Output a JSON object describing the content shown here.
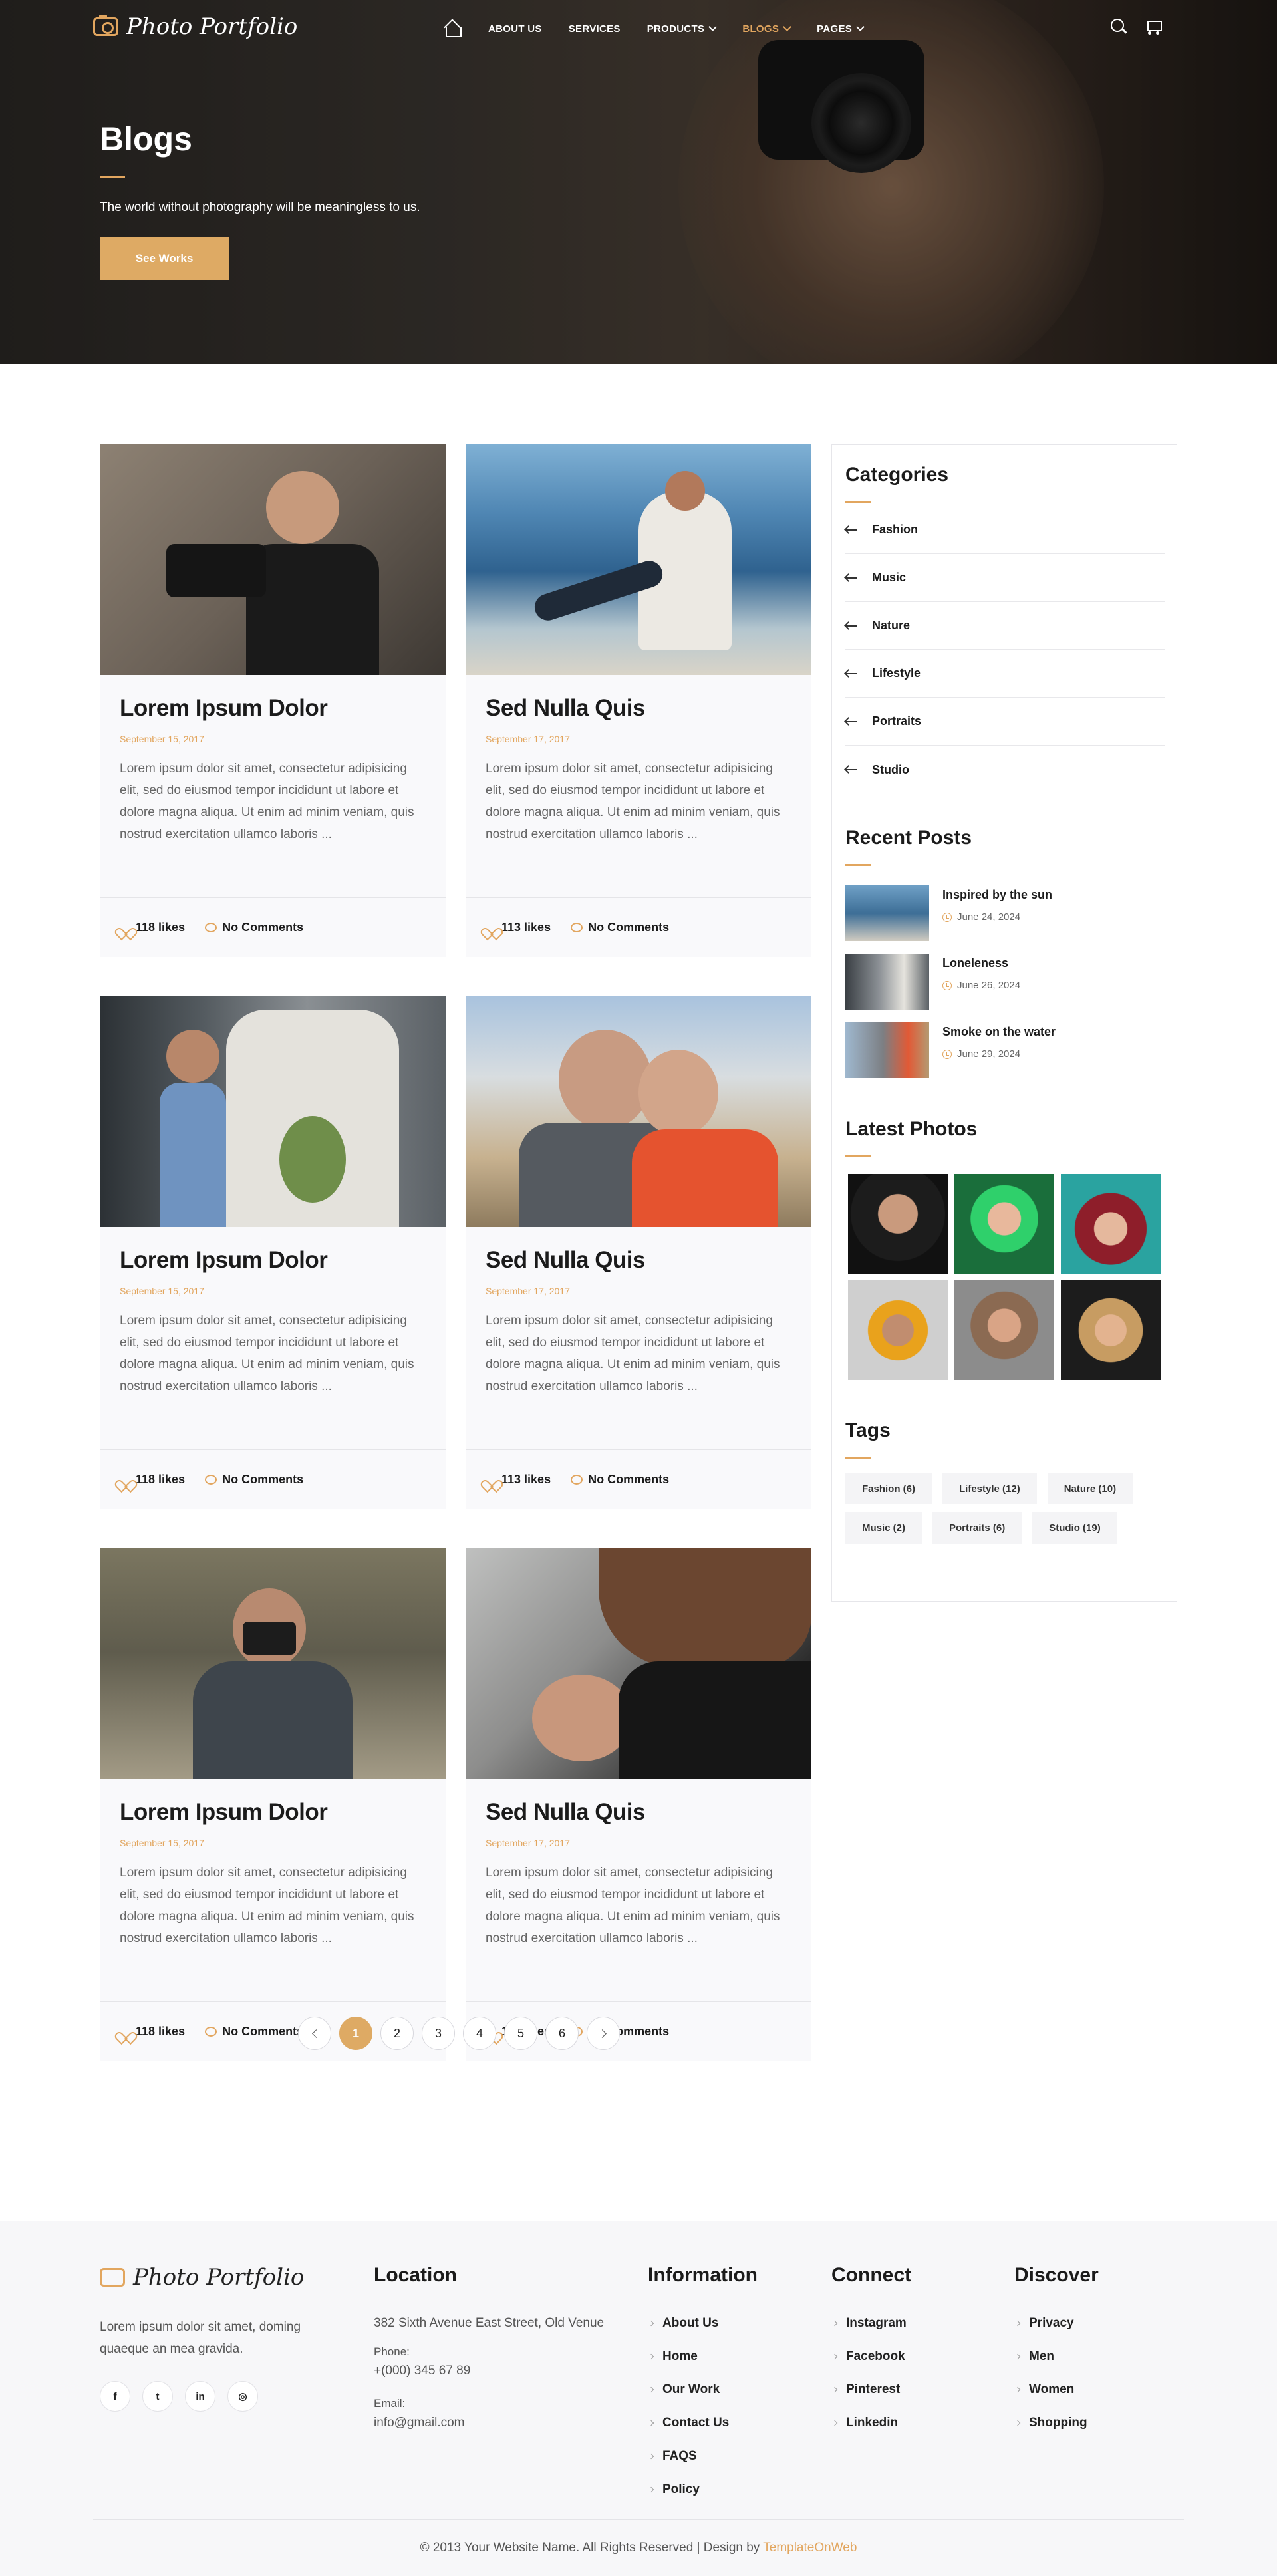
{
  "brand": {
    "name": "Photo Portfolio",
    "accent": "#e2a65f"
  },
  "nav": {
    "home_icon": "home-icon",
    "items": [
      {
        "label": "ABOUT US"
      },
      {
        "label": "SERVICES"
      },
      {
        "label": "PRODUCTS",
        "dropdown": true
      },
      {
        "label": "BLOGS",
        "dropdown": true,
        "active": true
      },
      {
        "label": "PAGES",
        "dropdown": true
      }
    ],
    "search_icon": "search-icon",
    "cart_icon": "cart-icon"
  },
  "hero": {
    "title": "Blogs",
    "subtitle": "The world without photography will be meaningless to us.",
    "button": "See Works"
  },
  "posts": [
    {
      "title": "Lorem Ipsum Dolor",
      "date": "September 15, 2017",
      "excerpt": "Lorem ipsum dolor sit amet, consectetur adipisicing elit, sed do eiusmod tempor incididunt ut labore et dolore magna aliqua. Ut enim ad minim veniam, quis nostrud exercitation ullamco laboris ...",
      "likes": "118 likes",
      "comments": "No Comments"
    },
    {
      "title": "Sed Nulla Quis",
      "date": "September 17, 2017",
      "excerpt": "Lorem ipsum dolor sit amet, consectetur adipisicing elit, sed do eiusmod tempor incididunt ut labore et dolore magna aliqua. Ut enim ad minim veniam, quis nostrud exercitation ullamco laboris ...",
      "likes": "113 likes",
      "comments": "No Comments"
    },
    {
      "title": "Lorem Ipsum Dolor",
      "date": "September 15, 2017",
      "excerpt": "Lorem ipsum dolor sit amet, consectetur adipisicing elit, sed do eiusmod tempor incididunt ut labore et dolore magna aliqua. Ut enim ad minim veniam, quis nostrud exercitation ullamco laboris ...",
      "likes": "118 likes",
      "comments": "No Comments"
    },
    {
      "title": "Sed Nulla Quis",
      "date": "September 17, 2017",
      "excerpt": "Lorem ipsum dolor sit amet, consectetur adipisicing elit, sed do eiusmod tempor incididunt ut labore et dolore magna aliqua. Ut enim ad minim veniam, quis nostrud exercitation ullamco laboris ...",
      "likes": "113 likes",
      "comments": "No Comments"
    },
    {
      "title": "Lorem Ipsum Dolor",
      "date": "September 15, 2017",
      "excerpt": "Lorem ipsum dolor sit amet, consectetur adipisicing elit, sed do eiusmod tempor incididunt ut labore et dolore magna aliqua. Ut enim ad minim veniam, quis nostrud exercitation ullamco laboris ...",
      "likes": "118 likes",
      "comments": "No Comments"
    },
    {
      "title": "Sed Nulla Quis",
      "date": "September 17, 2017",
      "excerpt": "Lorem ipsum dolor sit amet, consectetur adipisicing elit, sed do eiusmod tempor incididunt ut labore et dolore magna aliqua. Ut enim ad minim veniam, quis nostrud exercitation ullamco laboris ...",
      "likes": "113 likes",
      "comments": "No Comments"
    }
  ],
  "sidebar": {
    "categories_title": "Categories",
    "categories": [
      "Fashion",
      "Music",
      "Nature",
      "Lifestyle",
      "Portraits",
      "Studio"
    ],
    "recent_title": "Recent Posts",
    "recent": [
      {
        "title": "Inspired by the sun",
        "date": "June 24, 2024"
      },
      {
        "title": "Loneleness",
        "date": "June 26, 2024"
      },
      {
        "title": "Smoke on the water",
        "date": "June 29, 2024"
      }
    ],
    "photos_title": "Latest Photos",
    "tags_title": "Tags",
    "tags": [
      "Fashion (6)",
      "Lifestyle (12)",
      "Nature (10)",
      "Music (2)",
      "Portraits (6)",
      "Studio (19)"
    ]
  },
  "pagination": {
    "pages": [
      "1",
      "2",
      "3",
      "4",
      "5",
      "6"
    ],
    "current": "1"
  },
  "footer": {
    "about": "Lorem ipsum dolor sit amet, doming quaeque an mea gravida.",
    "social_icons": [
      "facebook-icon",
      "twitter-icon",
      "linkedin-icon",
      "instagram-icon"
    ],
    "location_title": "Location",
    "address": "382 Sixth Avenue East Street, Old Venue",
    "phone_label": "Phone:",
    "phone": "+(000) 345 67 89",
    "email_label": "Email:",
    "email": "info@gmail.com",
    "information_title": "Information",
    "information": [
      "About Us",
      "Home",
      "Our Work",
      "Contact Us",
      "FAQS",
      "Policy"
    ],
    "connect_title": "Connect",
    "connect": [
      "Instagram",
      "Facebook",
      "Pinterest",
      "Linkedin"
    ],
    "discover_title": "Discover",
    "discover": [
      "Privacy",
      "Men",
      "Women",
      "Shopping"
    ],
    "copyright": "© 2013 Your Website Name. All Rights Reserved | Design by",
    "credit": "TemplateOnWeb"
  }
}
